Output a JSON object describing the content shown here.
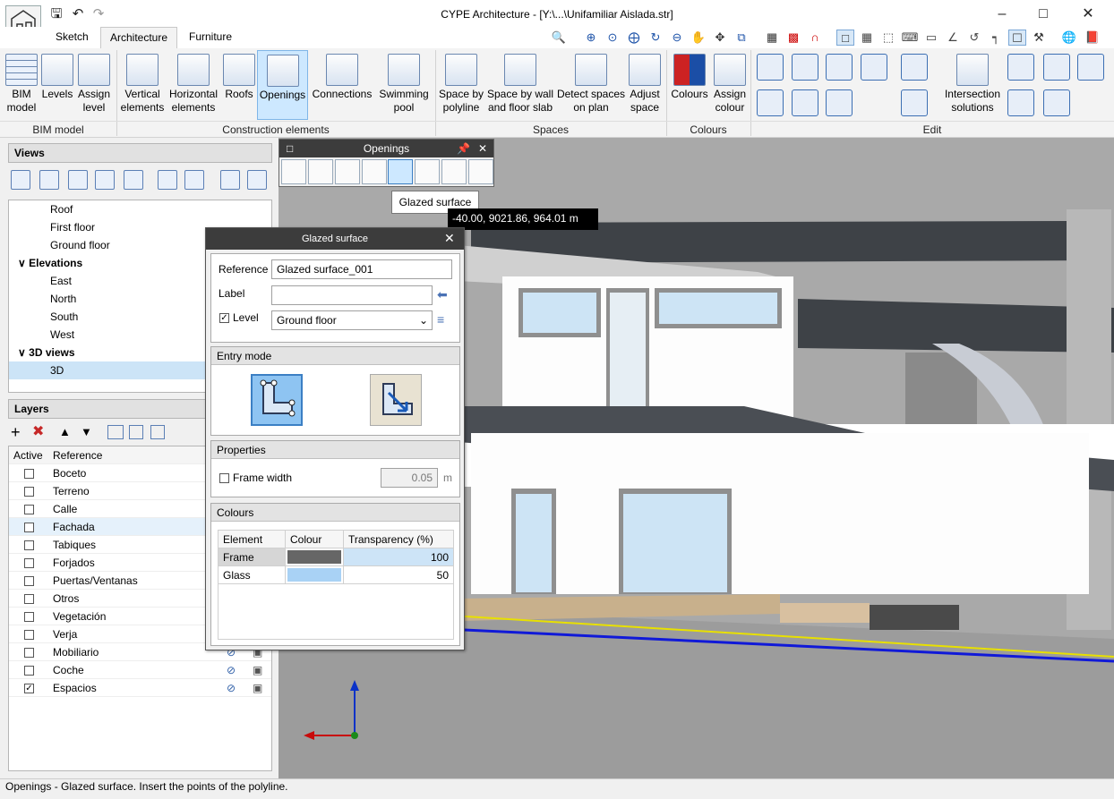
{
  "window": {
    "title": "CYPE Architecture - [Y:\\...\\Unifamiliar Aislada.str]"
  },
  "tabs": [
    "Sketch",
    "Architecture",
    "Furniture"
  ],
  "ribbon": {
    "buttons": [
      {
        "label": "BIM model",
        "icon": "grid-icon"
      },
      {
        "label": "Levels",
        "icon": "levels-icon"
      },
      {
        "label": "Assign level",
        "icon": "assign-level-icon"
      },
      {
        "label": "Vertical elements",
        "icon": "wall-icon"
      },
      {
        "label": "Horizontal elements",
        "icon": "slab-icon"
      },
      {
        "label": "Roofs",
        "icon": "roof-icon"
      },
      {
        "label": "Openings",
        "icon": "window-icon"
      },
      {
        "label": "Connections",
        "icon": "stairs-icon"
      },
      {
        "label": "Swimming pool",
        "icon": "pool-icon"
      },
      {
        "label": "Space by polyline",
        "icon": "cube-icon"
      },
      {
        "label": "Space by wall and floor slab",
        "icon": "cube-icon"
      },
      {
        "label": "Detect spaces on plan",
        "icon": "cube-icon"
      },
      {
        "label": "Adjust space",
        "icon": "cube-icon"
      },
      {
        "label": "Colours",
        "icon": "palette-icon"
      },
      {
        "label": "Assign colour",
        "icon": "bucket-icon"
      },
      {
        "label": "Intersection solutions",
        "icon": "cube-icon"
      }
    ],
    "groups": [
      "BIM model",
      "Construction elements",
      "Spaces",
      "Colours",
      "Edit"
    ]
  },
  "views": {
    "title": "Views",
    "items": [
      {
        "label": "Roof",
        "level": 2
      },
      {
        "label": "First floor",
        "level": 2
      },
      {
        "label": "Ground floor",
        "level": 2
      },
      {
        "label": "Elevations",
        "level": 1
      },
      {
        "label": "East",
        "level": 2
      },
      {
        "label": "North",
        "level": 2
      },
      {
        "label": "South",
        "level": 2
      },
      {
        "label": "West",
        "level": 2
      },
      {
        "label": "3D views",
        "level": 1
      },
      {
        "label": "3D",
        "level": 2
      }
    ]
  },
  "layers": {
    "title": "Layers",
    "columns": [
      "Active",
      "Reference"
    ],
    "rows": [
      {
        "name": "Boceto",
        "active": false
      },
      {
        "name": "Terreno",
        "active": false
      },
      {
        "name": "Calle",
        "active": false
      },
      {
        "name": "Fachada",
        "active": false
      },
      {
        "name": "Tabiques",
        "active": false
      },
      {
        "name": "Forjados",
        "active": false
      },
      {
        "name": "Puertas/Ventanas",
        "active": false
      },
      {
        "name": "Otros",
        "active": false
      },
      {
        "name": "Vegetación",
        "active": false
      },
      {
        "name": "Verja",
        "active": false
      },
      {
        "name": "Mobiliario",
        "active": false
      },
      {
        "name": "Coche",
        "active": false
      },
      {
        "name": "Espacios",
        "active": true
      }
    ]
  },
  "openings_panel": {
    "title": "Openings",
    "tooltip": "Glazed surface"
  },
  "coord_readout": "-40.00, 9021.86, 964.01 m",
  "dialog": {
    "title": "Glazed surface",
    "reference_label": "Reference",
    "reference_value": "Glazed surface_001",
    "label_label": "Label",
    "label_value": "",
    "level_label": "Level",
    "level_checked": true,
    "level_value": "Ground floor",
    "entry_mode": "Entry mode",
    "properties": "Properties",
    "frame_width_label": "Frame width",
    "frame_width_value": "0.05",
    "frame_width_unit": "m",
    "colours": "Colours",
    "colour_headers": [
      "Element",
      "Colour",
      "Transparency (%)"
    ],
    "colour_rows": [
      {
        "element": "Frame",
        "color": "#666666",
        "transparency": "100"
      },
      {
        "element": "Glass",
        "color": "#a9d2f5",
        "transparency": "50"
      }
    ]
  },
  "status": "Openings - Glazed surface. Insert the points of the polyline."
}
